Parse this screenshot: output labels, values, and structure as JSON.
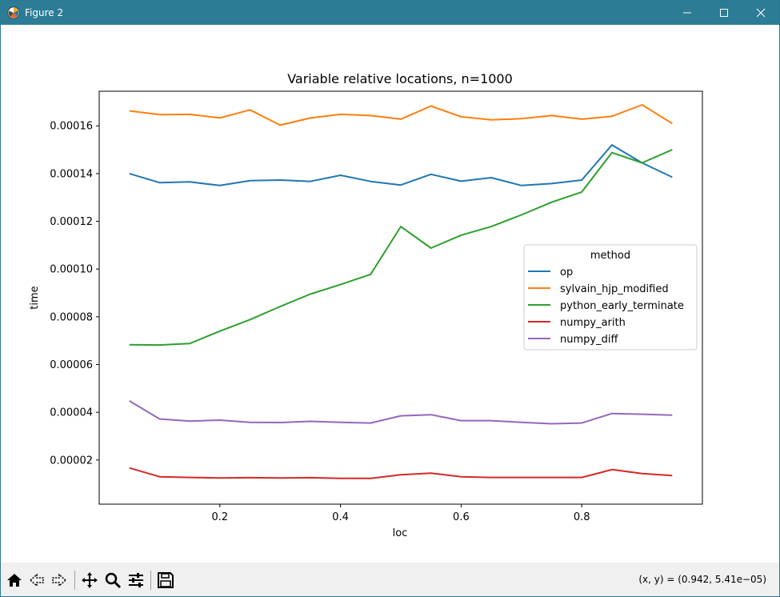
{
  "window": {
    "title": "Figure 2",
    "titlebar_color": "#2d7c96"
  },
  "toolbar": {
    "buttons": [
      "home-icon",
      "back-icon",
      "forward-icon",
      "pan-icon",
      "zoom-icon",
      "configure-subplots-icon",
      "save-icon"
    ],
    "coords_text": "(x, y) = (0.942, 5.41e−05)"
  },
  "chart_data": {
    "type": "line",
    "title": "Variable relative locations, n=1000",
    "xlabel": "loc",
    "ylabel": "time",
    "xlim": [
      0.0,
      1.0
    ],
    "ylim": [
      1.5e-06,
      0.0001745
    ],
    "xticks": [
      0.2,
      0.4,
      0.6,
      0.8
    ],
    "xtick_labels": [
      "0.2",
      "0.4",
      "0.6",
      "0.8"
    ],
    "yticks": [
      2e-05,
      4e-05,
      6e-05,
      8e-05,
      0.0001,
      0.00012,
      0.00014,
      0.00016
    ],
    "ytick_labels": [
      "0.00002",
      "0.00004",
      "0.00006",
      "0.00008",
      "0.00010",
      "0.00012",
      "0.00014",
      "0.00016"
    ],
    "grid": false,
    "legend": {
      "title": "method",
      "placement": "center-right"
    },
    "x": [
      0.05,
      0.1,
      0.15,
      0.2,
      0.25,
      0.3,
      0.35,
      0.4,
      0.45,
      0.5,
      0.55,
      0.6,
      0.65,
      0.7,
      0.75,
      0.8,
      0.85,
      0.9,
      0.95
    ],
    "series": [
      {
        "name": "op",
        "color": "#1f77b4",
        "values": [
          0.00014,
          0.0001362,
          0.0001365,
          0.000135,
          0.000137,
          0.0001373,
          0.0001367,
          0.0001393,
          0.0001367,
          0.0001352,
          0.0001397,
          0.0001368,
          0.0001383,
          0.000135,
          0.0001358,
          0.0001373,
          0.000152,
          0.0001445,
          0.0001385
        ]
      },
      {
        "name": "sylvain_hjp_modified",
        "color": "#ff7f0e",
        "values": [
          0.0001663,
          0.0001647,
          0.0001648,
          0.0001633,
          0.0001667,
          0.0001603,
          0.0001633,
          0.0001648,
          0.0001643,
          0.0001628,
          0.0001683,
          0.0001638,
          0.0001625,
          0.000163,
          0.0001643,
          0.0001628,
          0.000164,
          0.0001688,
          0.000161
        ]
      },
      {
        "name": "python_early_terminate",
        "color": "#2ca02c",
        "values": [
          6.83e-05,
          6.82e-05,
          6.88e-05,
          7.4e-05,
          7.88e-05,
          8.43e-05,
          8.95e-05,
          9.35e-05,
          9.78e-05,
          0.0001178,
          0.0001088,
          0.0001142,
          0.0001178,
          0.0001227,
          0.000128,
          0.0001323,
          0.0001488,
          0.0001445,
          0.00015
        ]
      },
      {
        "name": "numpy_arith",
        "color": "#d62728",
        "values": [
          1.67e-05,
          1.3e-05,
          1.27e-05,
          1.25e-05,
          1.26e-05,
          1.25e-05,
          1.26e-05,
          1.23e-05,
          1.23e-05,
          1.38e-05,
          1.45e-05,
          1.3e-05,
          1.27e-05,
          1.27e-05,
          1.27e-05,
          1.27e-05,
          1.6e-05,
          1.43e-05,
          1.35e-05
        ]
      },
      {
        "name": "numpy_diff",
        "color": "#9467bd",
        "values": [
          4.48e-05,
          3.72e-05,
          3.63e-05,
          3.67e-05,
          3.58e-05,
          3.57e-05,
          3.62e-05,
          3.58e-05,
          3.55e-05,
          3.85e-05,
          3.9e-05,
          3.65e-05,
          3.65e-05,
          3.58e-05,
          3.52e-05,
          3.55e-05,
          3.95e-05,
          3.92e-05,
          3.88e-05
        ]
      }
    ]
  }
}
